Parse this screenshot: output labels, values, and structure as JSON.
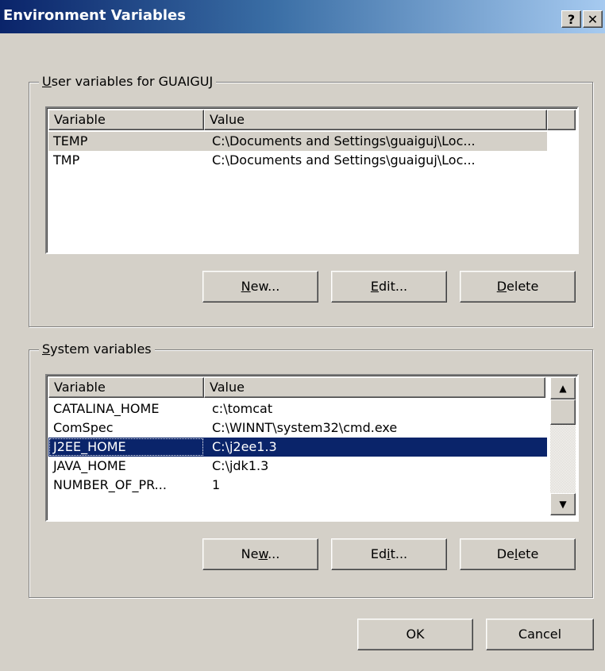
{
  "window": {
    "title": "Environment Variables",
    "help_label": "?",
    "close_label": "✕"
  },
  "user_group": {
    "legend_prefix": "",
    "legend_accel": "U",
    "legend_rest": "ser variables for GUAIGUJ",
    "columns": [
      "Variable",
      "Value"
    ],
    "rows": [
      {
        "variable": "TEMP",
        "value": "C:\\Documents and Settings\\guaiguj\\Loc..."
      },
      {
        "variable": "TMP",
        "value": "C:\\Documents and Settings\\guaiguj\\Loc..."
      }
    ],
    "buttons": {
      "new_accel": "N",
      "new_rest": "ew...",
      "edit_accel": "E",
      "edit_rest": "dit...",
      "delete_accel": "D",
      "delete_rest": "elete"
    }
  },
  "system_group": {
    "legend_accel": "S",
    "legend_rest": "ystem variables",
    "columns": [
      "Variable",
      "Value"
    ],
    "rows": [
      {
        "variable": "CATALINA_HOME",
        "value": "c:\\tomcat"
      },
      {
        "variable": "ComSpec",
        "value": "C:\\WINNT\\system32\\cmd.exe"
      },
      {
        "variable": "J2EE_HOME",
        "value": "C:\\j2ee1.3"
      },
      {
        "variable": "JAVA_HOME",
        "value": "C:\\jdk1.3"
      },
      {
        "variable": "NUMBER_OF_PR...",
        "value": "1"
      }
    ],
    "selected_row": "J2EE_HOME",
    "buttons": {
      "new_pre": "Ne",
      "new_accel": "w",
      "new_post": "...",
      "edit_pre": "Ed",
      "edit_accel": "i",
      "edit_post": "t...",
      "delete_pre": "De",
      "delete_accel": "l",
      "delete_post": "ete"
    }
  },
  "footer": {
    "ok_label": "OK",
    "cancel_label": "Cancel"
  },
  "icons": {
    "scroll_up": "triangle-up-icon",
    "scroll_down": "triangle-down-icon"
  }
}
